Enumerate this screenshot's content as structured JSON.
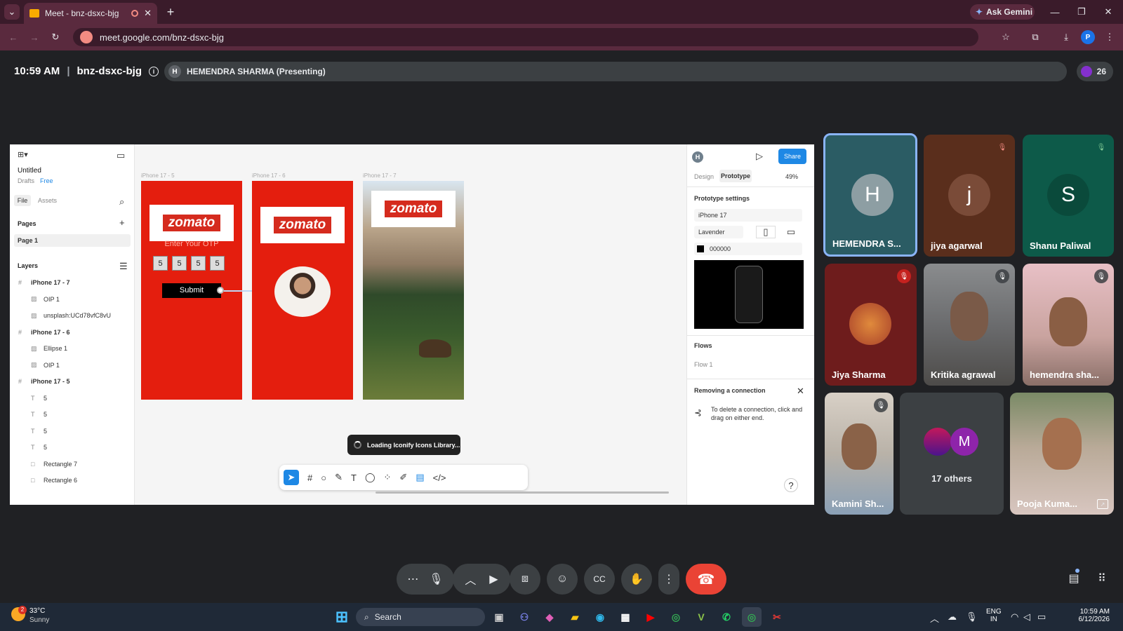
{
  "browser": {
    "tab_title": "Meet - bnz-dsxc-bjg",
    "url": "meet.google.com/bnz-dsxc-bjg",
    "ask_gemini": "Ask Gemini",
    "profile_initial": "P"
  },
  "meeting": {
    "time": "10:59 AM",
    "code": "bnz-dsxc-bjg",
    "presenter_initial": "H",
    "presenter_label": "HEMENDRA SHARMA (Presenting)",
    "participant_count": "26"
  },
  "figma": {
    "file_name": "Untitled",
    "drafts": "Drafts",
    "plan": "Free",
    "tab_file": "File",
    "tab_assets": "Assets",
    "pages_header": "Pages",
    "page_1": "Page 1",
    "layers_header": "Layers",
    "layers": [
      {
        "name": "iPhone 17 - 7",
        "kind": "frame"
      },
      {
        "name": "OIP 1",
        "kind": "image"
      },
      {
        "name": "unsplash:UCd78vfC8vU",
        "kind": "image"
      },
      {
        "name": "iPhone 17 - 6",
        "kind": "frame"
      },
      {
        "name": "Ellipse 1",
        "kind": "image"
      },
      {
        "name": "OIP 1",
        "kind": "image"
      },
      {
        "name": "iPhone 17 - 5",
        "kind": "frame"
      },
      {
        "name": "5",
        "kind": "text"
      },
      {
        "name": "5",
        "kind": "text"
      },
      {
        "name": "5",
        "kind": "text"
      },
      {
        "name": "5",
        "kind": "text"
      },
      {
        "name": "Rectangle 7",
        "kind": "rect"
      },
      {
        "name": "Rectangle 6",
        "kind": "rect"
      }
    ],
    "frames": [
      "iPhone 17 - 5",
      "iPhone 17 - 6",
      "iPhone 17 - 7"
    ],
    "logo_text": "zomato",
    "otp_prompt": "Enter Your OTP",
    "otp_digits": [
      "5",
      "5",
      "5",
      "5"
    ],
    "submit_label": "Submit",
    "loading_toast": "Loading Iconify Icons Library...",
    "user_initial": "H",
    "share_label": "Share",
    "tab_design": "Design",
    "tab_prototype": "Prototype",
    "zoom": "49%",
    "prototype_settings": "Prototype settings",
    "device": "iPhone 17",
    "device_color": "Lavender",
    "background_hex": "000000",
    "flows_header": "Flows",
    "flow_1": "Flow 1",
    "hint_title": "Removing a connection",
    "hint_text": "To delete a connection, click and drag on either end.",
    "help": "?"
  },
  "participants": [
    {
      "name": "HEMENDRA S...",
      "initial": "H",
      "muted": false,
      "active": true
    },
    {
      "name": "jiya agarwal",
      "initial": "j",
      "muted": true
    },
    {
      "name": "Shanu Paliwal",
      "initial": "S",
      "muted": true
    },
    {
      "name": "Jiya Sharma",
      "muted": true
    },
    {
      "name": "Kritika agrawal",
      "muted": true
    },
    {
      "name": "hemendra sha...",
      "muted": true
    },
    {
      "name": "Kamini Sh...",
      "muted": true
    },
    {
      "name": "17 others",
      "initial": "M"
    },
    {
      "name": "Pooja Kuma..."
    }
  ],
  "taskbar": {
    "temp": "33°C",
    "weather": "Sunny",
    "weather_badge": "2",
    "search": "Search",
    "lang_1": "ENG",
    "lang_2": "IN",
    "time": "10:59 AM",
    "date": "6/12/2026"
  }
}
